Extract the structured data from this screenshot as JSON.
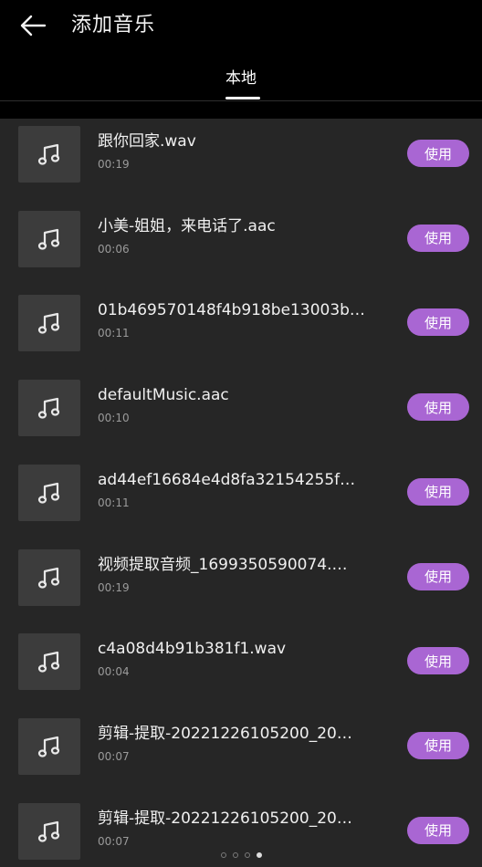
{
  "header": {
    "back_icon": "arrow-left-icon",
    "title": "添加音乐"
  },
  "tabs": [
    {
      "label": "本地",
      "active": true
    }
  ],
  "item_icon": "music-note-icon",
  "use_label": "使用",
  "items": [
    {
      "name": "跟你回家.wav",
      "duration": "00:19"
    },
    {
      "name": "小美-姐姐，来电话了.aac",
      "duration": "00:06"
    },
    {
      "name": "01b469570148f4b918be13003b…",
      "duration": "00:11"
    },
    {
      "name": "defaultMusic.aac",
      "duration": "00:10"
    },
    {
      "name": "ad44ef16684e4d8fa32154255f…",
      "duration": "00:11"
    },
    {
      "name": "视频提取音频_1699350590074.…",
      "duration": "00:19"
    },
    {
      "name": "c4a08d4b91b381f1.wav",
      "duration": "00:04"
    },
    {
      "name": "剪辑-提取-20221226105200_20…",
      "duration": "00:07"
    },
    {
      "name": "剪辑-提取-20221226105200_20…",
      "duration": "00:07"
    }
  ],
  "colors": {
    "accent": "#a966d3",
    "background": "#242424",
    "header": "#000000"
  }
}
